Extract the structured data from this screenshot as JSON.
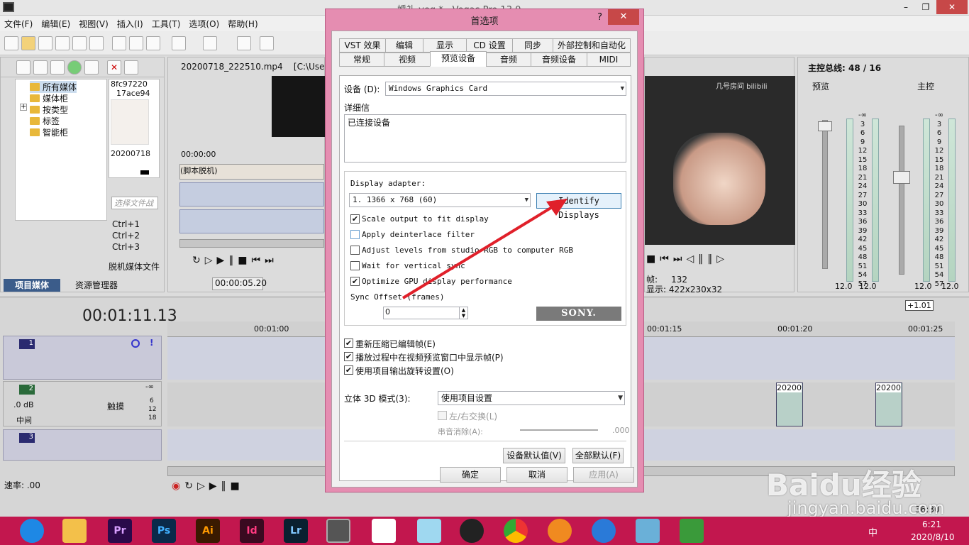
{
  "app": {
    "title": "婚礼.veg * - Vegas Pro 13.0",
    "minimize": "–",
    "maximize": "❐",
    "close": "✕"
  },
  "menu": [
    "文件(F)",
    "编辑(E)",
    "视图(V)",
    "插入(I)",
    "工具(T)",
    "选项(O)",
    "帮助(H)"
  ],
  "explorer": {
    "tree": [
      "所有媒体",
      "媒体柜",
      "按类型",
      "标签",
      "智能柜"
    ],
    "expand": "+",
    "thumb_name_1": "8fc97220",
    "thumb_name_2": "17ace94",
    "thumb_label": "20200718",
    "search_placeholder": "选择文件战",
    "shortcuts": [
      "Ctrl+1",
      "Ctrl+2",
      "Ctrl+3"
    ],
    "bottom_text": "脱机媒体文件",
    "tab_project": "项目媒体",
    "tab_explorer": "资源管理器"
  },
  "trimmer": {
    "file": "20200718_222510.mp4",
    "path": "[C:\\Users\\",
    "time": "00:00:00",
    "clip_label": "(脚本脱机)",
    "timecode": "00:00:05.20"
  },
  "timeline": {
    "time": "00:01:11.13",
    "marks": [
      "00:01:00",
      "00:01:15",
      "00:01:20",
      "00:01:25"
    ],
    "rate_label": "速率: .00",
    "tail_time": "36:30",
    "speed": "+1.01"
  },
  "tracks": [
    {
      "num": "1"
    },
    {
      "num": "2",
      "db": ".0 dB",
      "pan": "中间",
      "mode": "触摸",
      "level": "-∞",
      "levels": [
        "6",
        "12",
        "18"
      ]
    },
    {
      "num": "3"
    }
  ],
  "clips": [
    {
      "label": "20200"
    },
    {
      "label": "20200"
    }
  ],
  "preview": {
    "watermark": "几号房间 bilibili",
    "frame_label": "帧:",
    "frame_value": "132",
    "display_label": "显示:",
    "display_value": "422x230x32"
  },
  "mixer": {
    "title": "主控总线: 48 / 16",
    "preview_label": "预览",
    "master_label": "主控",
    "scale": [
      "-∞",
      "3",
      "6",
      "9",
      "12",
      "15",
      "18",
      "21",
      "24",
      "27",
      "30",
      "33",
      "36",
      "39",
      "42",
      "45",
      "48",
      "51",
      "54",
      "57"
    ],
    "scale_top": "-∞",
    "values": [
      "12.0",
      "12.0",
      "12.0",
      "12.0"
    ]
  },
  "dialog": {
    "title": "首选项",
    "help": "?",
    "close": "✕",
    "tabs_row1": [
      "VST 效果",
      "编辑",
      "显示",
      "CD 设置",
      "同步",
      "外部控制和自动化"
    ],
    "tabs_row2": [
      "常规",
      "视频",
      "预览设备",
      "音频",
      "音频设备",
      "MIDI"
    ],
    "selected_tab": "预览设备",
    "device_label": "设备 (D):",
    "device_value": "Windows Graphics Card",
    "details_label": "详细信",
    "details_value": "已连接设备",
    "adapter_label": "Display adapter:",
    "adapter_value": "1. 1366 x 768 (60)",
    "identify_button": "Identify Displays",
    "options": [
      {
        "label": "Scale output to fit display",
        "checked": true
      },
      {
        "label": "Apply deinterlace filter",
        "checked": false
      },
      {
        "label": "Adjust levels from studio RGB to computer RGB",
        "checked": false
      },
      {
        "label": "Wait for vertical sync",
        "checked": false
      },
      {
        "label": "Optimize GPU display performance",
        "checked": true
      }
    ],
    "sync_label": "Sync Offset (frames)",
    "sync_value": "0",
    "brand": "SONY.",
    "checks": [
      {
        "label": "重新压缩已编辑帧(E)",
        "checked": true
      },
      {
        "label": "播放过程中在视频预览窗口中显示帧(P)",
        "checked": true
      },
      {
        "label": "使用项目输出旋转设置(O)",
        "checked": true
      }
    ],
    "stereo_label": "立体 3D 模式(3):",
    "stereo_value": "使用项目设置",
    "swap_label": "左/右交换(L)",
    "crosstalk_label": "串音消除(A):",
    "crosstalk_value": ".000",
    "device_default": "设备默认值(V)",
    "all_default": "全部默认(F)",
    "ok": "确定",
    "cancel": "取消",
    "apply": "应用(A)"
  },
  "taskbar": {
    "apps": [
      "Pr",
      "Ps",
      "Ai",
      "Id",
      "Lr"
    ],
    "time": "6:21",
    "date": "2020/8/10",
    "ime": "中",
    "watermark": "Baidu经验",
    "watermark_url": "jingyan.baidu.com"
  },
  "colors": {
    "dialog_frame": "#e58db1",
    "taskbar": "#c2174e",
    "close": "#c74848",
    "arrow": "#e0202a"
  }
}
